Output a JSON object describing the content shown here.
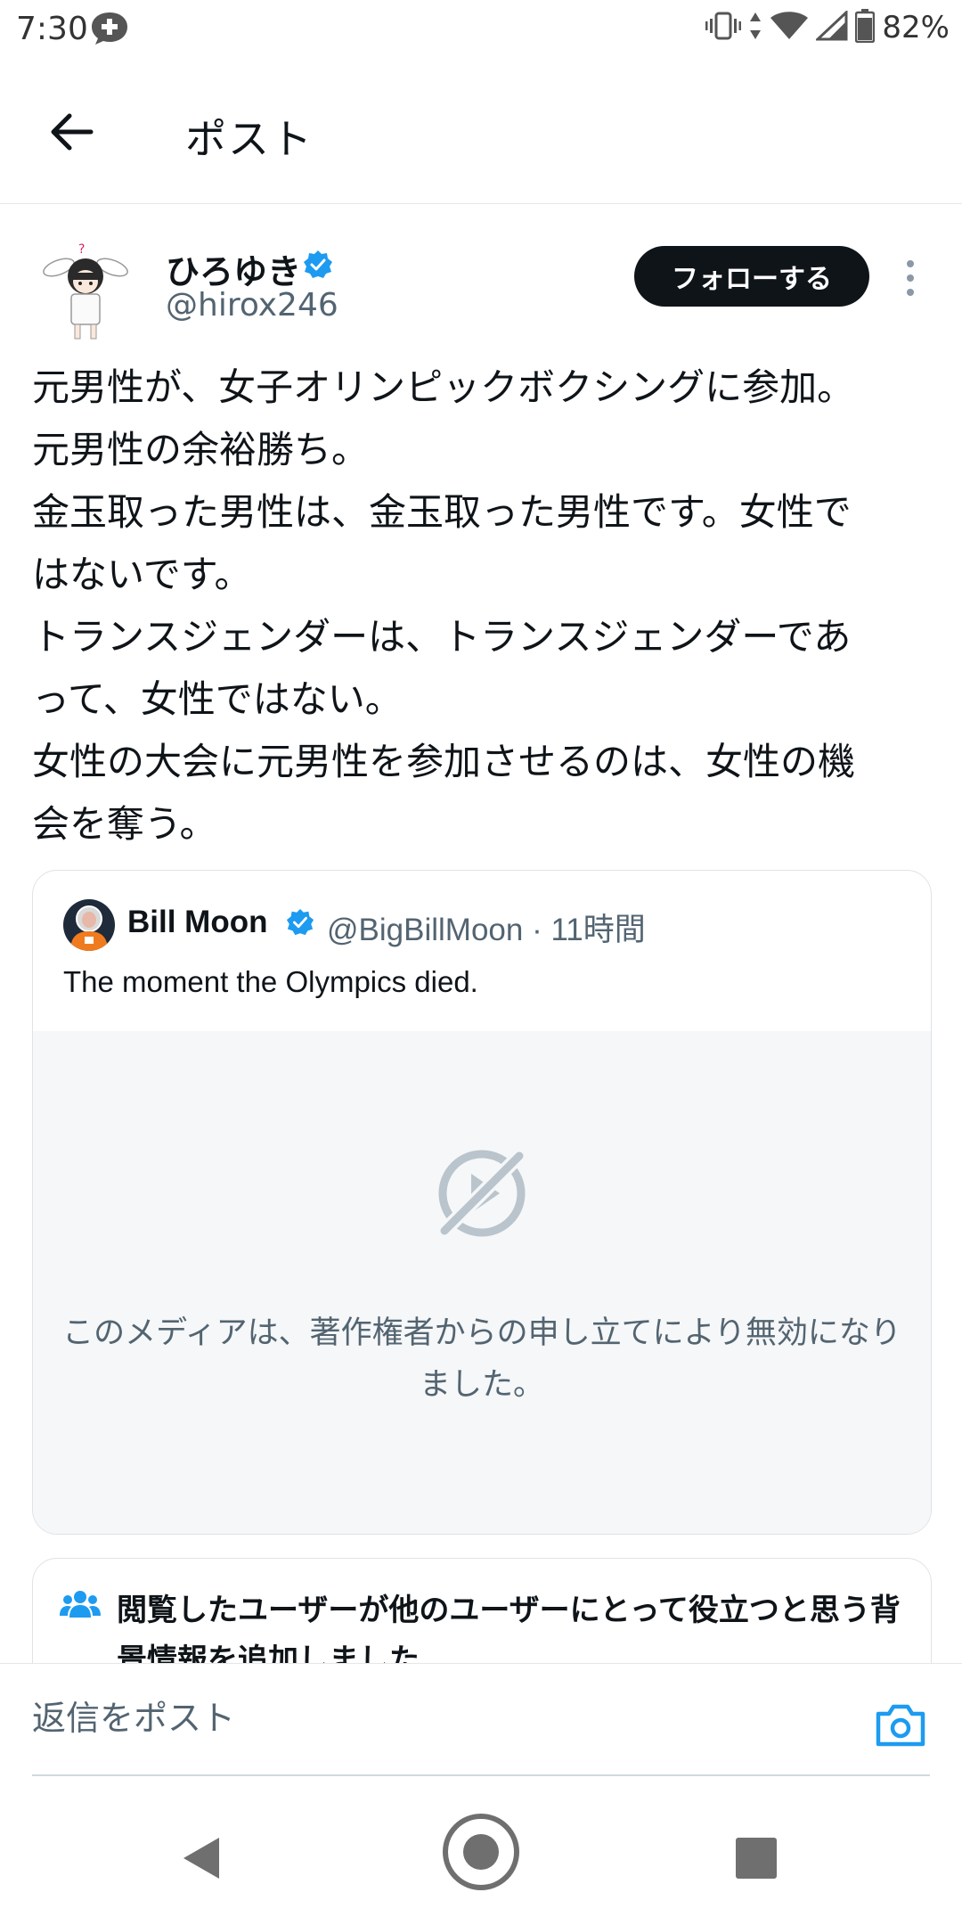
{
  "status_bar": {
    "time": "7:30",
    "battery": "82%",
    "icons": [
      "app-notification-icon",
      "vibrate-icon",
      "data-arrows-icon",
      "wifi-icon",
      "signal-icon",
      "battery-icon"
    ]
  },
  "app_bar": {
    "back_icon": "arrow-left-icon",
    "title": "ポスト"
  },
  "post": {
    "author_name": "ひろゆき",
    "author_handle": "@hirox246",
    "verified": true,
    "follow_label": "フォローする",
    "more_icon": "more-vertical-icon",
    "body_lines": [
      "元男性が、女子オリンピックボクシングに参加。",
      "元男性の余裕勝ち。",
      "金玉取った男性は、金玉取った男性です。女性で",
      "はないです。",
      "トランスジェンダーは、トランスジェンダーであ",
      "って、女性ではない。",
      "女性の大会に元男性を参加させるのは、女性の機",
      "会を奪う。"
    ]
  },
  "quote": {
    "author_name": "Bill Moon",
    "handle_time": "@BigBillMoon · 11時間",
    "verified": true,
    "text": "The moment the Olympics died.",
    "media_icon": "media-disabled-icon",
    "media_message": "このメディアは、著作権者からの申し立てにより無効になりました。"
  },
  "community_note": {
    "icon": "people-icon",
    "text": "閲覧したユーザーが他のユーザーにとって役立つと思う背景情報を追加しました"
  },
  "reply": {
    "placeholder": "返信をポスト",
    "camera_icon": "camera-icon"
  },
  "nav_bar": {
    "icons": [
      "nav-back-icon",
      "nav-home-icon",
      "nav-recents-icon"
    ]
  },
  "colors": {
    "verified_blue": "#1d9bf0",
    "text_primary": "#0f1419",
    "text_secondary": "#536471",
    "follow_bg": "#0f1419"
  }
}
